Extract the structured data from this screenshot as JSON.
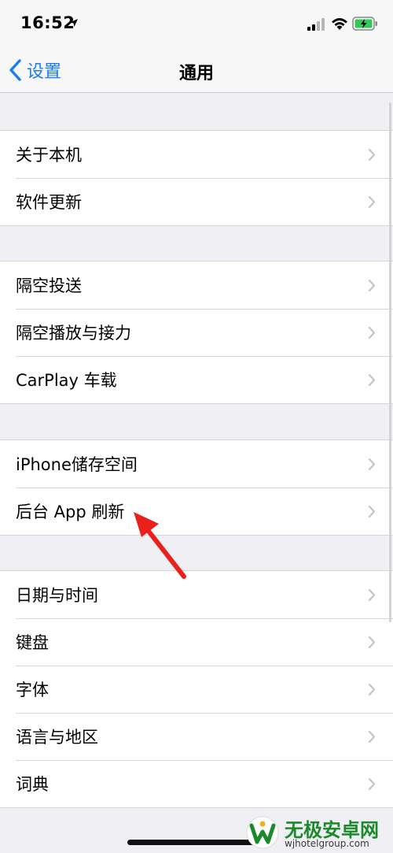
{
  "status_bar": {
    "time": "16:52",
    "icons": [
      "location-arrow-icon",
      "cellular-signal-icon",
      "wifi-icon",
      "battery-charging-icon"
    ]
  },
  "nav": {
    "back_label": "设置",
    "title": "通用"
  },
  "groups": [
    {
      "items": [
        "关于本机",
        "软件更新"
      ]
    },
    {
      "items": [
        "隔空投送",
        "隔空播放与接力",
        "CarPlay 车载"
      ]
    },
    {
      "items": [
        "iPhone储存空间",
        "后台 App 刷新"
      ]
    },
    {
      "items": [
        "日期与时间",
        "键盘",
        "字体",
        "语言与地区",
        "词典"
      ]
    }
  ],
  "colors": {
    "accent": "#1a7cf3",
    "background": "#efeff4",
    "annotation": "#e8211c",
    "watermark": "#1b8a2a"
  },
  "watermark": {
    "title": "无极安卓网",
    "subtitle": "wjhotelgroup.com"
  }
}
